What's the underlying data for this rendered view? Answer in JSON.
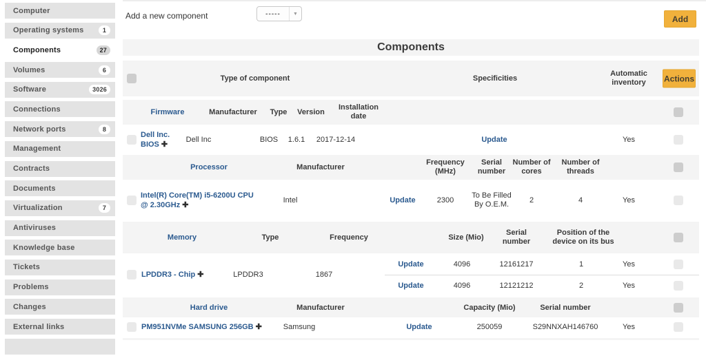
{
  "sidebar": {
    "items": [
      {
        "label": "Computer",
        "badge": "",
        "active": false
      },
      {
        "label": "Operating systems",
        "badge": "1",
        "active": false
      },
      {
        "label": "Components",
        "badge": "27",
        "active": true
      },
      {
        "label": "Volumes",
        "badge": "6",
        "active": false
      },
      {
        "label": "Software",
        "badge": "3026",
        "active": false
      },
      {
        "label": "Connections",
        "badge": "",
        "active": false
      },
      {
        "label": "Network ports",
        "badge": "8",
        "active": false
      },
      {
        "label": "Management",
        "badge": "",
        "active": false
      },
      {
        "label": "Contracts",
        "badge": "",
        "active": false
      },
      {
        "label": "Documents",
        "badge": "",
        "active": false
      },
      {
        "label": "Virtualization",
        "badge": "7",
        "active": false
      },
      {
        "label": "Antiviruses",
        "badge": "",
        "active": false
      },
      {
        "label": "Knowledge base",
        "badge": "",
        "active": false
      },
      {
        "label": "Tickets",
        "badge": "",
        "active": false
      },
      {
        "label": "Problems",
        "badge": "",
        "active": false
      },
      {
        "label": "Changes",
        "badge": "",
        "active": false
      },
      {
        "label": "External links",
        "badge": "",
        "active": false
      },
      {
        "label": "",
        "badge": "",
        "active": false
      }
    ]
  },
  "toolbar": {
    "label": "Add a new component",
    "dropdown_value": "-----",
    "add_button": "Add"
  },
  "icons": {
    "plus": "✚",
    "caret": "▼"
  },
  "colors": {
    "accent_orange": "#f1b13c",
    "link_blue": "#2b5a8f"
  },
  "table": {
    "title": "Components",
    "main_header": {
      "type": "Type of component",
      "specificities": "Specificities",
      "auto": "Automatic inventory",
      "actions": "Actions"
    },
    "firmware": {
      "section": "Firmware",
      "h_manufacturer": "Manufacturer",
      "h_type": "Type",
      "h_version": "Version",
      "h_install": "Installation date",
      "name1": "Dell Inc.",
      "name2": "BIOS",
      "manufacturer": "Dell Inc",
      "type": "BIOS",
      "version": "1.6.1",
      "install": "2017-12-14",
      "update": "Update",
      "auto": "Yes"
    },
    "processor": {
      "section": "Processor",
      "h_manufacturer": "Manufacturer",
      "h_freq": "Frequency (MHz)",
      "h_serial": "Serial number",
      "h_cores": "Number of cores",
      "h_threads": "Number of threads",
      "name1": "Intel(R) Core(TM) i5-6200U CPU",
      "name2": "@ 2.30GHz",
      "manufacturer": "Intel",
      "update": "Update",
      "freq": "2300",
      "serial": "To Be Filled By O.E.M.",
      "cores": "2",
      "threads": "4",
      "auto": "Yes"
    },
    "memory": {
      "section": "Memory",
      "h_type": "Type",
      "h_freq": "Frequency",
      "h_size": "Size (Mio)",
      "h_serial": "Serial number",
      "h_position": "Position of the device on its bus",
      "name": "LPDDR3 - Chip",
      "type": "LPDDR3",
      "freq": "1867",
      "rows": [
        {
          "update": "Update",
          "size": "4096",
          "serial": "12161217",
          "position": "1",
          "auto": "Yes"
        },
        {
          "update": "Update",
          "size": "4096",
          "serial": "12121212",
          "position": "2",
          "auto": "Yes"
        }
      ]
    },
    "harddrive": {
      "section": "Hard drive",
      "h_manufacturer": "Manufacturer",
      "h_capacity": "Capacity (Mio)",
      "h_serial": "Serial number",
      "name": "PM951NVMe SAMSUNG 256GB",
      "manufacturer": "Samsung",
      "update": "Update",
      "capacity": "250059",
      "serial": "S29NNXAH146760",
      "auto": "Yes"
    }
  }
}
